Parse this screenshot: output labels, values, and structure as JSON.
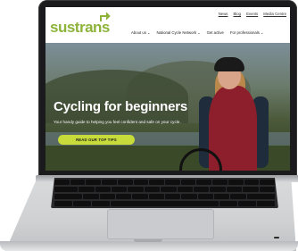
{
  "site": {
    "logo_text": "sustrans",
    "utility_links": [
      "News",
      "Blog",
      "Events",
      "Media Centre"
    ],
    "main_menu": [
      "About us",
      "National Cycle Network",
      "Get active",
      "For professionals"
    ]
  },
  "hero": {
    "title": "Cycling for beginners",
    "subtitle": "Your handy guide to helping you feel confident and safe on your cycle.",
    "cta_label": "READ OUR TOP TIPS"
  },
  "colors": {
    "brand_green": "#8db33a",
    "cta_yellow_green": "#c7dc3a",
    "laptop_silver": "#d9dadc",
    "bezel": "#1b1b1d"
  },
  "icons": {
    "logo_mark": "arrow-up-right-icon"
  }
}
